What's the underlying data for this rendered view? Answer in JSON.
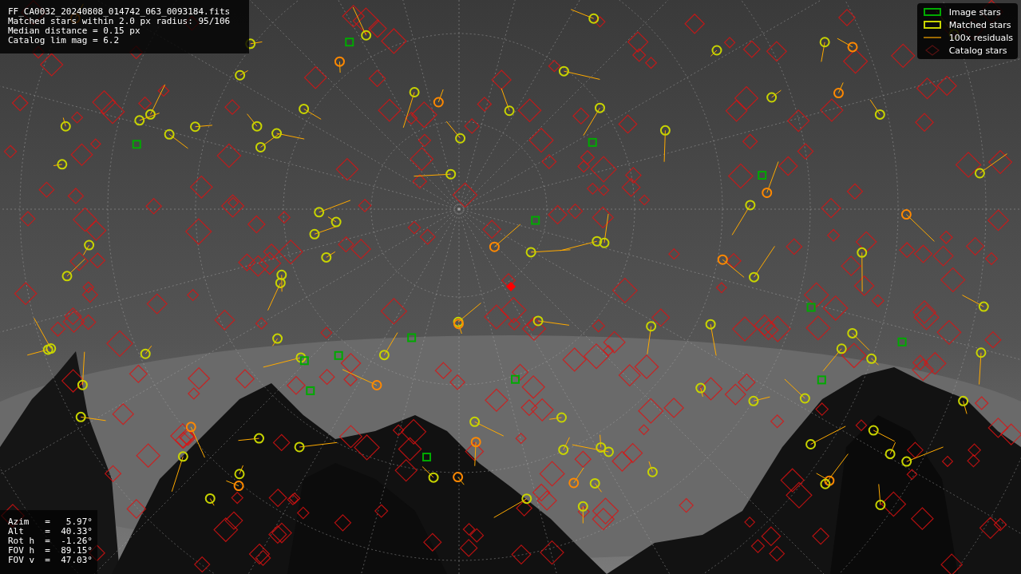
{
  "info_box": {
    "lines": [
      "FF_CA0032_20240808_014742_063_0093184.fits",
      "Matched stars within 2.0 px radius: 95/106",
      "Median distance = 0.15 px",
      "Catalog lim mag = 6.2"
    ]
  },
  "legend": {
    "items": [
      {
        "label": "Image stars"
      },
      {
        "kind": "matched",
        "label": "Matched stars"
      },
      {
        "kind": "residual",
        "label": "100x residuals"
      },
      {
        "kind": "catalog",
        "label": "Catalog stars"
      }
    ]
  },
  "pointing": {
    "lines": [
      "Azim   =   5.97°",
      "Alt    =  40.33°",
      "Rot h  =  -1.26°",
      "FOV h  =  89.15°",
      "FOV v  =  47.03°"
    ]
  }
}
